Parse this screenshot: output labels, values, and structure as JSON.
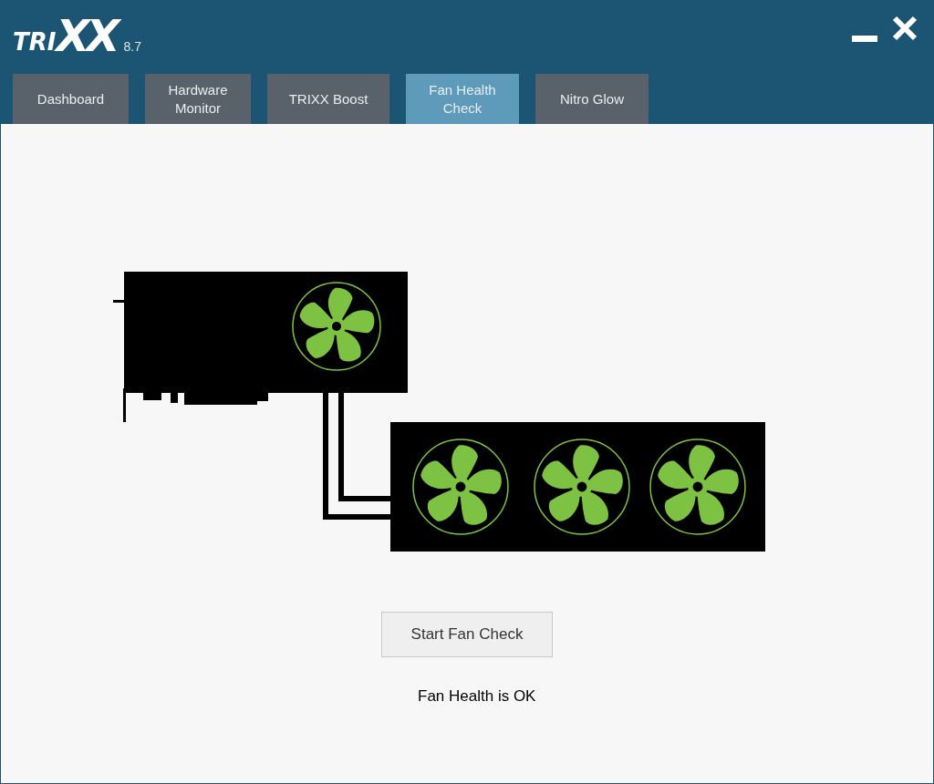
{
  "app": {
    "logo_prefix": "TRI",
    "logo_suffix": "XX",
    "version": "8.7"
  },
  "tabs": [
    {
      "label": "Dashboard",
      "selected": false
    },
    {
      "label": "Hardware\nMonitor",
      "selected": false
    },
    {
      "label": "TRIXX Boost",
      "selected": false
    },
    {
      "label": "Fan Health\nCheck",
      "selected": true
    },
    {
      "label": "Nitro Glow",
      "selected": false
    }
  ],
  "fan_check": {
    "button": "Start Fan Check",
    "status": "Fan Health is OK"
  }
}
